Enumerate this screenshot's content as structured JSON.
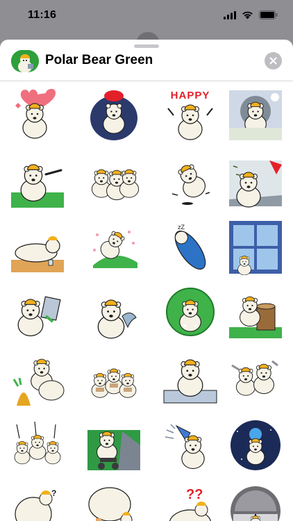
{
  "status_bar": {
    "time": "11:16",
    "icons": [
      "cellular-signal-icon",
      "wifi-icon",
      "battery-icon"
    ]
  },
  "sheet": {
    "title": "Polar Bear Green",
    "close_icon": "close-x-icon",
    "accent_green": "#2e9f3b"
  },
  "stickers": [
    "heart-bear-sticker",
    "bean-bag-bear-sticker",
    "happy-bear-sticker",
    "stormy-desk-bear-sticker",
    "pointing-bear-sticker",
    "three-bears-sticker",
    "falling-bear-sticker",
    "wind-umbrella-bear-sticker",
    "lying-bear-sticker",
    "flower-hill-bear-sticker",
    "sleeping-bag-bear-sticker",
    "window-bear-sticker",
    "reading-bear-sticker",
    "bear-with-dolphin-sticker",
    "bush-bear-sticker",
    "tree-stump-bear-sticker",
    "pineapple-bear-sticker",
    "marching-bears-sticker",
    "thinking-bear-sticker",
    "bears-cheering-sticker",
    "waving-bears-sticker",
    "scooter-bear-sticker",
    "megaphone-bear-sticker",
    "space-bear-sticker",
    "question-bear-sticker",
    "back-bear-sticker",
    "double-question-bear-sticker",
    "helmet-peek-bear-sticker"
  ]
}
